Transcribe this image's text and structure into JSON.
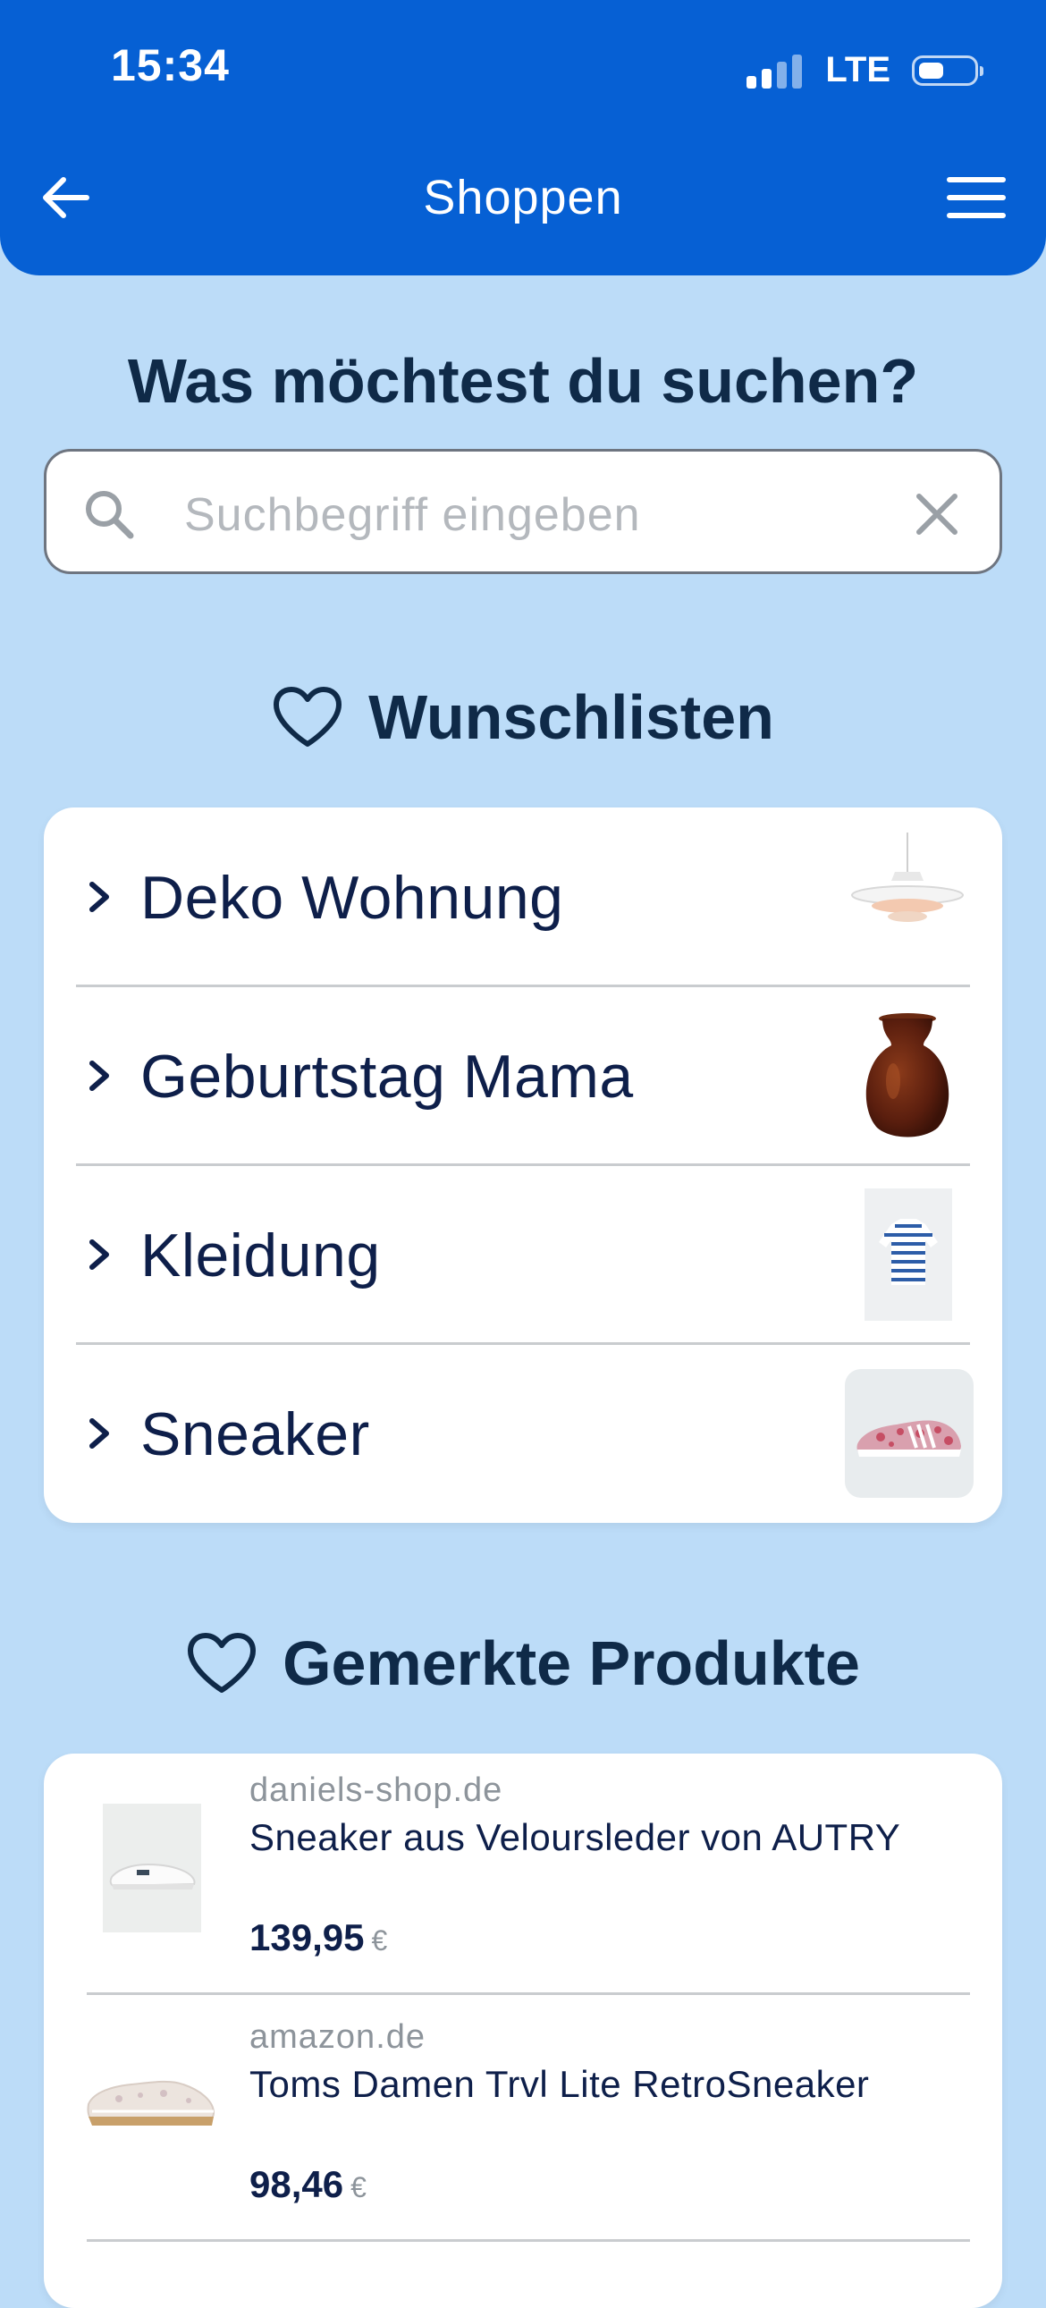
{
  "status_bar": {
    "time": "15:34",
    "network": "LTE",
    "signal_bars": 4,
    "signal_bars_active": 2,
    "battery_level_fraction": 0.45
  },
  "header": {
    "title": "Shoppen",
    "back_icon": "arrow-left-icon",
    "menu_icon": "hamburger-menu-icon",
    "background_color": "#0660d4"
  },
  "search": {
    "heading": "Was möchtest du suchen?",
    "placeholder": "Suchbegriff eingeben",
    "value": "",
    "search_icon": "search-icon",
    "clear_icon": "close-icon"
  },
  "wishlists": {
    "heading": "Wunschlisten",
    "icon": "heart-icon",
    "items": [
      {
        "label": "Deko Wohnung",
        "thumbnail": "pendant-lamp-image"
      },
      {
        "label": "Geburtstag Mama",
        "thumbnail": "brown-vase-image"
      },
      {
        "label": "Kleidung",
        "thumbnail": "striped-shirt-image"
      },
      {
        "label": "Sneaker",
        "thumbnail": "floral-sneaker-image"
      }
    ]
  },
  "saved_products": {
    "heading": "Gemerkte Produkte",
    "icon": "heart-icon",
    "items": [
      {
        "shop": "daniels-shop.de",
        "name": "Sneaker aus Veloursleder von AUTRY",
        "price": "139,95",
        "currency": "€",
        "image": "white-sneaker-image"
      },
      {
        "shop": "amazon.de",
        "name": "Toms Damen Trvl Lite RetroSneaker",
        "price": "98,46",
        "currency": "€",
        "image": "beige-sneaker-image"
      }
    ]
  },
  "colors": {
    "page_background": "#bcdcf8",
    "header": "#0660d4",
    "heading_text": "#0f2a48",
    "item_text": "#0e1f4a",
    "muted_text": "#8d949b"
  }
}
